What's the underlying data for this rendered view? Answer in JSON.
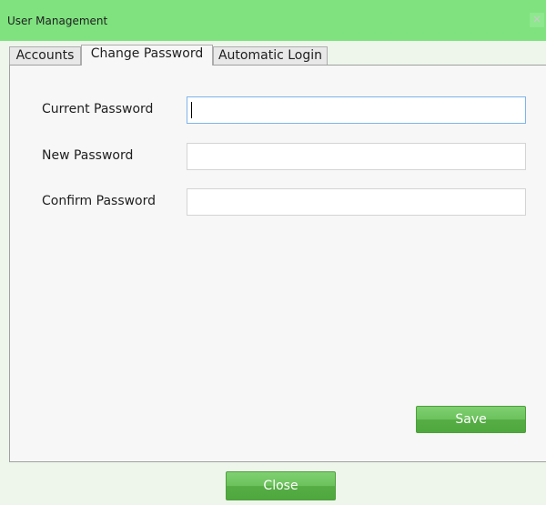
{
  "window": {
    "title": "User Management",
    "close_icon": "close-icon"
  },
  "tabs": [
    {
      "label": "Accounts",
      "active": false
    },
    {
      "label": "Change Password",
      "active": true
    },
    {
      "label": "Automatic Login",
      "active": false
    }
  ],
  "form": {
    "current_password": {
      "label": "Current Password",
      "value": "",
      "placeholder": ""
    },
    "new_password": {
      "label": "New Password",
      "value": "",
      "placeholder": ""
    },
    "confirm_password": {
      "label": "Confirm Password",
      "value": "",
      "placeholder": ""
    }
  },
  "buttons": {
    "save": "Save",
    "close": "Close"
  },
  "colors": {
    "title_bar": "#7fe27f",
    "button_green": "#6cc25c",
    "input_focus_border": "#7eb4ea"
  }
}
